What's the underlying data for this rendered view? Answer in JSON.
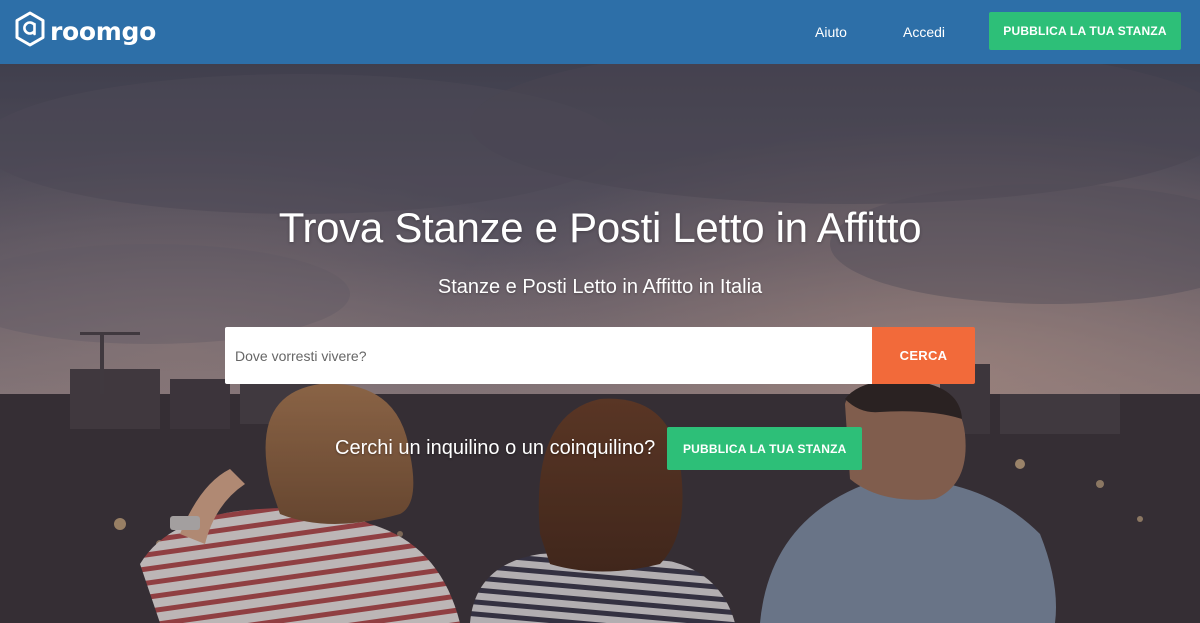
{
  "header": {
    "brand": "roomgo",
    "nav": {
      "help": "Aiuto",
      "login": "Accedi"
    },
    "cta": "PUBBLICA LA TUA STANZA"
  },
  "hero": {
    "title": "Trova Stanze e Posti Letto in Affitto",
    "subtitle": "Stanze e Posti Letto in Affitto in Italia",
    "search": {
      "placeholder": "Dove vorresti vivere?",
      "value": "",
      "button": "CERCA"
    },
    "tenant_prompt": "Cerchi un inquilino o un coinquilino?",
    "tenant_cta": "PUBBLICA LA TUA STANZA"
  },
  "colors": {
    "header_bg": "#2d6fa8",
    "green_button": "#2dbf78",
    "search_button": "#f26a3a"
  },
  "icons": {
    "logo": "roomgo-logo-icon"
  }
}
